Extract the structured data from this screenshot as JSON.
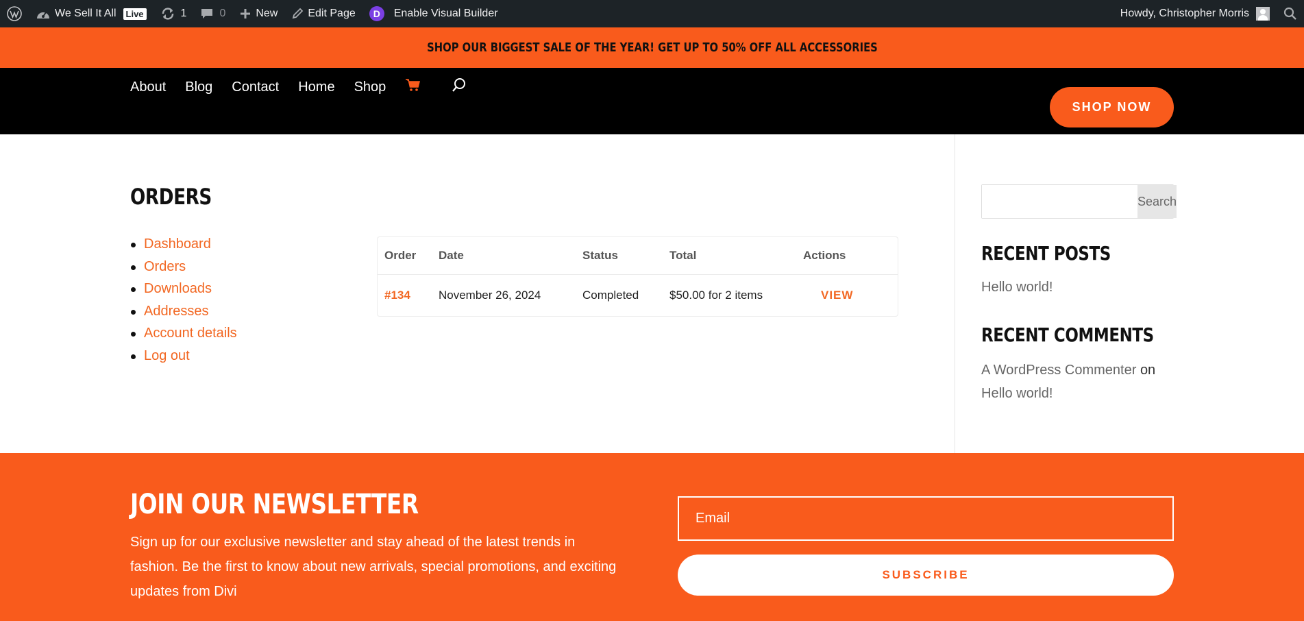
{
  "admin_bar": {
    "site_name": "We Sell It All",
    "live_badge": "Live",
    "updates_count": "1",
    "comments_count": "0",
    "new_label": "New",
    "edit_page_label": "Edit Page",
    "divi_badge_letter": "D",
    "visual_builder_label": "Enable Visual Builder",
    "greeting": "Howdy, Christopher Morris"
  },
  "promo": {
    "text": "SHOP OUR BIGGEST SALE OF THE YEAR! GET UP TO 50% OFF ALL ACCESSORIES"
  },
  "nav": {
    "items": [
      {
        "label": "About"
      },
      {
        "label": "Blog"
      },
      {
        "label": "Contact"
      },
      {
        "label": "Home"
      },
      {
        "label": "Shop"
      }
    ],
    "cta_label": "SHOP NOW"
  },
  "account": {
    "page_title": "ORDERS",
    "menu": [
      {
        "label": "Dashboard"
      },
      {
        "label": "Orders"
      },
      {
        "label": "Downloads"
      },
      {
        "label": "Addresses"
      },
      {
        "label": "Account details"
      },
      {
        "label": "Log out"
      }
    ],
    "orders_table": {
      "headers": [
        "Order",
        "Date",
        "Status",
        "Total",
        "Actions"
      ],
      "rows": [
        {
          "order": "#134",
          "date": "November 26, 2024",
          "status": "Completed",
          "total": "$50.00 for 2 items",
          "action": "VIEW"
        }
      ]
    }
  },
  "sidebar": {
    "search_button": "Search",
    "recent_posts_title": "RECENT POSTS",
    "recent_posts": [
      "Hello world!"
    ],
    "recent_comments_title": "RECENT COMMENTS",
    "comment_author": "A WordPress Commenter",
    "comment_on": "on",
    "comment_post": "Hello world!"
  },
  "newsletter": {
    "title": "JOIN OUR NEWSLETTER",
    "text": "Sign up for our exclusive newsletter and stay ahead of the latest trends in fashion. Be the first to know about new arrivals, special promotions, and exciting updates from Divi",
    "email_placeholder": "Email",
    "subscribe_label": "SUBSCRIBE"
  },
  "colors": {
    "brand_orange": "#f95b1c",
    "link_orange": "#f26722",
    "admin_bar": "#1d2327",
    "header_bg": "#000000"
  }
}
